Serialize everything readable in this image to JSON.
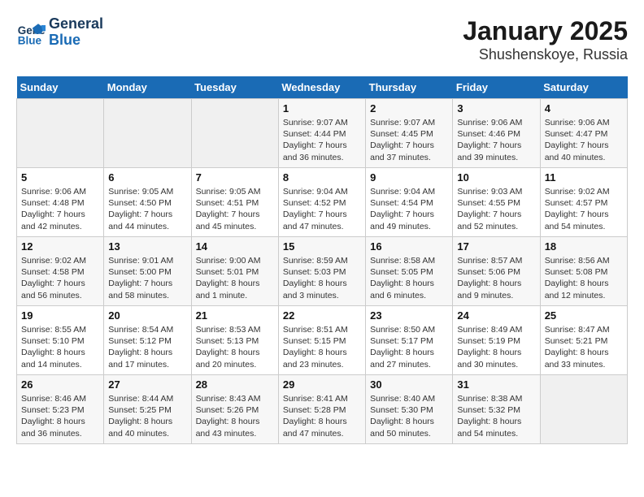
{
  "header": {
    "logo_line1": "General",
    "logo_line2": "Blue",
    "title": "January 2025",
    "subtitle": "Shushenskoye, Russia"
  },
  "days_of_week": [
    "Sunday",
    "Monday",
    "Tuesday",
    "Wednesday",
    "Thursday",
    "Friday",
    "Saturday"
  ],
  "weeks": [
    [
      {
        "num": "",
        "info": ""
      },
      {
        "num": "",
        "info": ""
      },
      {
        "num": "",
        "info": ""
      },
      {
        "num": "1",
        "info": "Sunrise: 9:07 AM\nSunset: 4:44 PM\nDaylight: 7 hours and 36 minutes."
      },
      {
        "num": "2",
        "info": "Sunrise: 9:07 AM\nSunset: 4:45 PM\nDaylight: 7 hours and 37 minutes."
      },
      {
        "num": "3",
        "info": "Sunrise: 9:06 AM\nSunset: 4:46 PM\nDaylight: 7 hours and 39 minutes."
      },
      {
        "num": "4",
        "info": "Sunrise: 9:06 AM\nSunset: 4:47 PM\nDaylight: 7 hours and 40 minutes."
      }
    ],
    [
      {
        "num": "5",
        "info": "Sunrise: 9:06 AM\nSunset: 4:48 PM\nDaylight: 7 hours and 42 minutes."
      },
      {
        "num": "6",
        "info": "Sunrise: 9:05 AM\nSunset: 4:50 PM\nDaylight: 7 hours and 44 minutes."
      },
      {
        "num": "7",
        "info": "Sunrise: 9:05 AM\nSunset: 4:51 PM\nDaylight: 7 hours and 45 minutes."
      },
      {
        "num": "8",
        "info": "Sunrise: 9:04 AM\nSunset: 4:52 PM\nDaylight: 7 hours and 47 minutes."
      },
      {
        "num": "9",
        "info": "Sunrise: 9:04 AM\nSunset: 4:54 PM\nDaylight: 7 hours and 49 minutes."
      },
      {
        "num": "10",
        "info": "Sunrise: 9:03 AM\nSunset: 4:55 PM\nDaylight: 7 hours and 52 minutes."
      },
      {
        "num": "11",
        "info": "Sunrise: 9:02 AM\nSunset: 4:57 PM\nDaylight: 7 hours and 54 minutes."
      }
    ],
    [
      {
        "num": "12",
        "info": "Sunrise: 9:02 AM\nSunset: 4:58 PM\nDaylight: 7 hours and 56 minutes."
      },
      {
        "num": "13",
        "info": "Sunrise: 9:01 AM\nSunset: 5:00 PM\nDaylight: 7 hours and 58 minutes."
      },
      {
        "num": "14",
        "info": "Sunrise: 9:00 AM\nSunset: 5:01 PM\nDaylight: 8 hours and 1 minute."
      },
      {
        "num": "15",
        "info": "Sunrise: 8:59 AM\nSunset: 5:03 PM\nDaylight: 8 hours and 3 minutes."
      },
      {
        "num": "16",
        "info": "Sunrise: 8:58 AM\nSunset: 5:05 PM\nDaylight: 8 hours and 6 minutes."
      },
      {
        "num": "17",
        "info": "Sunrise: 8:57 AM\nSunset: 5:06 PM\nDaylight: 8 hours and 9 minutes."
      },
      {
        "num": "18",
        "info": "Sunrise: 8:56 AM\nSunset: 5:08 PM\nDaylight: 8 hours and 12 minutes."
      }
    ],
    [
      {
        "num": "19",
        "info": "Sunrise: 8:55 AM\nSunset: 5:10 PM\nDaylight: 8 hours and 14 minutes."
      },
      {
        "num": "20",
        "info": "Sunrise: 8:54 AM\nSunset: 5:12 PM\nDaylight: 8 hours and 17 minutes."
      },
      {
        "num": "21",
        "info": "Sunrise: 8:53 AM\nSunset: 5:13 PM\nDaylight: 8 hours and 20 minutes."
      },
      {
        "num": "22",
        "info": "Sunrise: 8:51 AM\nSunset: 5:15 PM\nDaylight: 8 hours and 23 minutes."
      },
      {
        "num": "23",
        "info": "Sunrise: 8:50 AM\nSunset: 5:17 PM\nDaylight: 8 hours and 27 minutes."
      },
      {
        "num": "24",
        "info": "Sunrise: 8:49 AM\nSunset: 5:19 PM\nDaylight: 8 hours and 30 minutes."
      },
      {
        "num": "25",
        "info": "Sunrise: 8:47 AM\nSunset: 5:21 PM\nDaylight: 8 hours and 33 minutes."
      }
    ],
    [
      {
        "num": "26",
        "info": "Sunrise: 8:46 AM\nSunset: 5:23 PM\nDaylight: 8 hours and 36 minutes."
      },
      {
        "num": "27",
        "info": "Sunrise: 8:44 AM\nSunset: 5:25 PM\nDaylight: 8 hours and 40 minutes."
      },
      {
        "num": "28",
        "info": "Sunrise: 8:43 AM\nSunset: 5:26 PM\nDaylight: 8 hours and 43 minutes."
      },
      {
        "num": "29",
        "info": "Sunrise: 8:41 AM\nSunset: 5:28 PM\nDaylight: 8 hours and 47 minutes."
      },
      {
        "num": "30",
        "info": "Sunrise: 8:40 AM\nSunset: 5:30 PM\nDaylight: 8 hours and 50 minutes."
      },
      {
        "num": "31",
        "info": "Sunrise: 8:38 AM\nSunset: 5:32 PM\nDaylight: 8 hours and 54 minutes."
      },
      {
        "num": "",
        "info": ""
      }
    ]
  ]
}
